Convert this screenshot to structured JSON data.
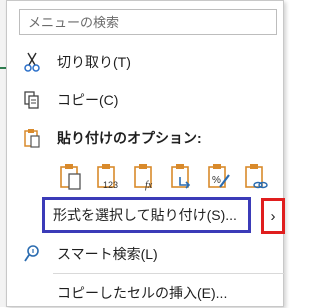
{
  "search": {
    "placeholder": "メニューの検索"
  },
  "menu": {
    "cut": {
      "label": "切り取り(T)",
      "icon": "scissors-icon"
    },
    "copy": {
      "label": "コピー(C)",
      "icon": "copy-icon"
    },
    "paste_options": {
      "label": "貼り付けのオプション:",
      "icon": "clipboard-icon"
    },
    "paste_buttons": [
      {
        "icon": "paste-icon"
      },
      {
        "icon": "paste-values-icon",
        "text": "123"
      },
      {
        "icon": "paste-formulas-icon",
        "text": "fx"
      },
      {
        "icon": "paste-transpose-icon"
      },
      {
        "icon": "paste-formatting-icon"
      },
      {
        "icon": "paste-link-icon"
      }
    ],
    "paste_special": {
      "label": "形式を選択して貼り付け(S)...",
      "chevron": "›"
    },
    "smart_lookup": {
      "label": "スマート検索(L)",
      "icon": "smart-lookup-icon"
    },
    "insert_copied": {
      "label": "コピーしたセルの挿入(E)..."
    }
  },
  "colors": {
    "highlight_blue": "#3b3bb8",
    "highlight_red": "#e01e1e",
    "clipboard_orange": "#d98a2b",
    "icon_blue": "#2b6cb0"
  }
}
